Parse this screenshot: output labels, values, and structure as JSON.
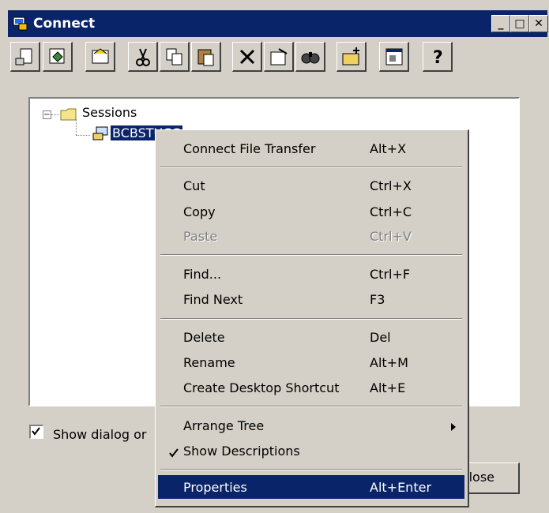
{
  "window": {
    "title": "Connect",
    "minimize_icon": "minimize-icon",
    "maximize_icon": "maximize-icon",
    "close_icon": "close-icon"
  },
  "toolbar": {
    "buttons": [
      "new-session-icon",
      "connect-icon",
      "quick-connect-icon",
      "cut-icon",
      "copy-icon",
      "paste-icon",
      "delete-icon",
      "properties-icon",
      "find-icon",
      "new-folder-icon",
      "session-options-icon",
      "help-icon"
    ]
  },
  "tree": {
    "root_label": "Sessions",
    "session_label": "BCBSTUCC"
  },
  "show_dialog_label": "Show dialog or",
  "close_button": "lose",
  "context_menu": {
    "items": [
      {
        "label": "Connect File Transfer",
        "shortcut": "Alt+X"
      },
      {
        "label": "Cut",
        "shortcut": "Ctrl+X"
      },
      {
        "label": "Copy",
        "shortcut": "Ctrl+C"
      },
      {
        "label": "Paste",
        "shortcut": "Ctrl+V"
      },
      {
        "label": "Find...",
        "shortcut": "Ctrl+F"
      },
      {
        "label": "Find Next",
        "shortcut": "F3"
      },
      {
        "label": "Delete",
        "shortcut": "Del"
      },
      {
        "label": "Rename",
        "shortcut": "Alt+M"
      },
      {
        "label": "Create Desktop Shortcut",
        "shortcut": "Alt+E"
      },
      {
        "label": "Arrange Tree",
        "shortcut": ""
      },
      {
        "label": "Show Descriptions",
        "shortcut": ""
      },
      {
        "label": "Properties",
        "shortcut": "Alt+Enter"
      }
    ]
  },
  "colors": {
    "title_bar": "#0a246a",
    "face": "#d4d0c8",
    "selection": "#0a246a"
  }
}
